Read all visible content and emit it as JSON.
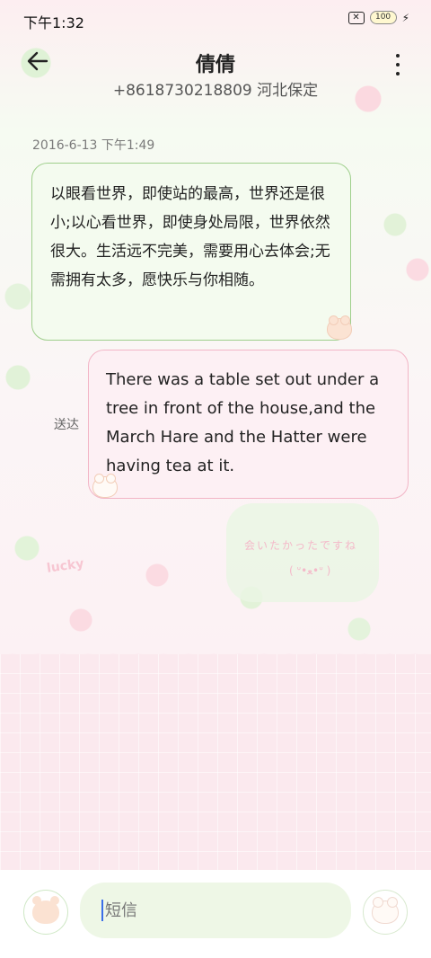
{
  "status_bar": {
    "time": "下午1:32",
    "battery": "100",
    "sim_icon": "x-sim-icon",
    "charging_icon": "bolt-icon"
  },
  "header": {
    "contact_name": "倩倩",
    "contact_subtitle": "+8618730218809 河北保定",
    "back_icon": "arrow-left-icon",
    "menu_icon": "more-vertical-icon"
  },
  "conversation": {
    "timestamp": "2016-6-13 下午1:49",
    "messages": [
      {
        "direction": "incoming",
        "text": "以眼看世界，即使站的最高，世界还是很小;以心看世界，即使身处局限，世界依然很大。生活远不完美，需要用心去体会;无需拥有太多，愿快乐与你相随。"
      },
      {
        "direction": "outgoing",
        "text": "There was a table set out under a tree in front of the house,and the March Hare and the Hatter were having tea at it.",
        "status": "送达"
      }
    ]
  },
  "decorations": {
    "card_text": "会いたかったですね",
    "card_face": "( ᐡ•ﻌ•ᐡ )",
    "lucky_text": "lucky"
  },
  "composer": {
    "placeholder": "短信",
    "left_icon": "bear-avatar-icon",
    "send_icon": "bear-send-icon"
  }
}
